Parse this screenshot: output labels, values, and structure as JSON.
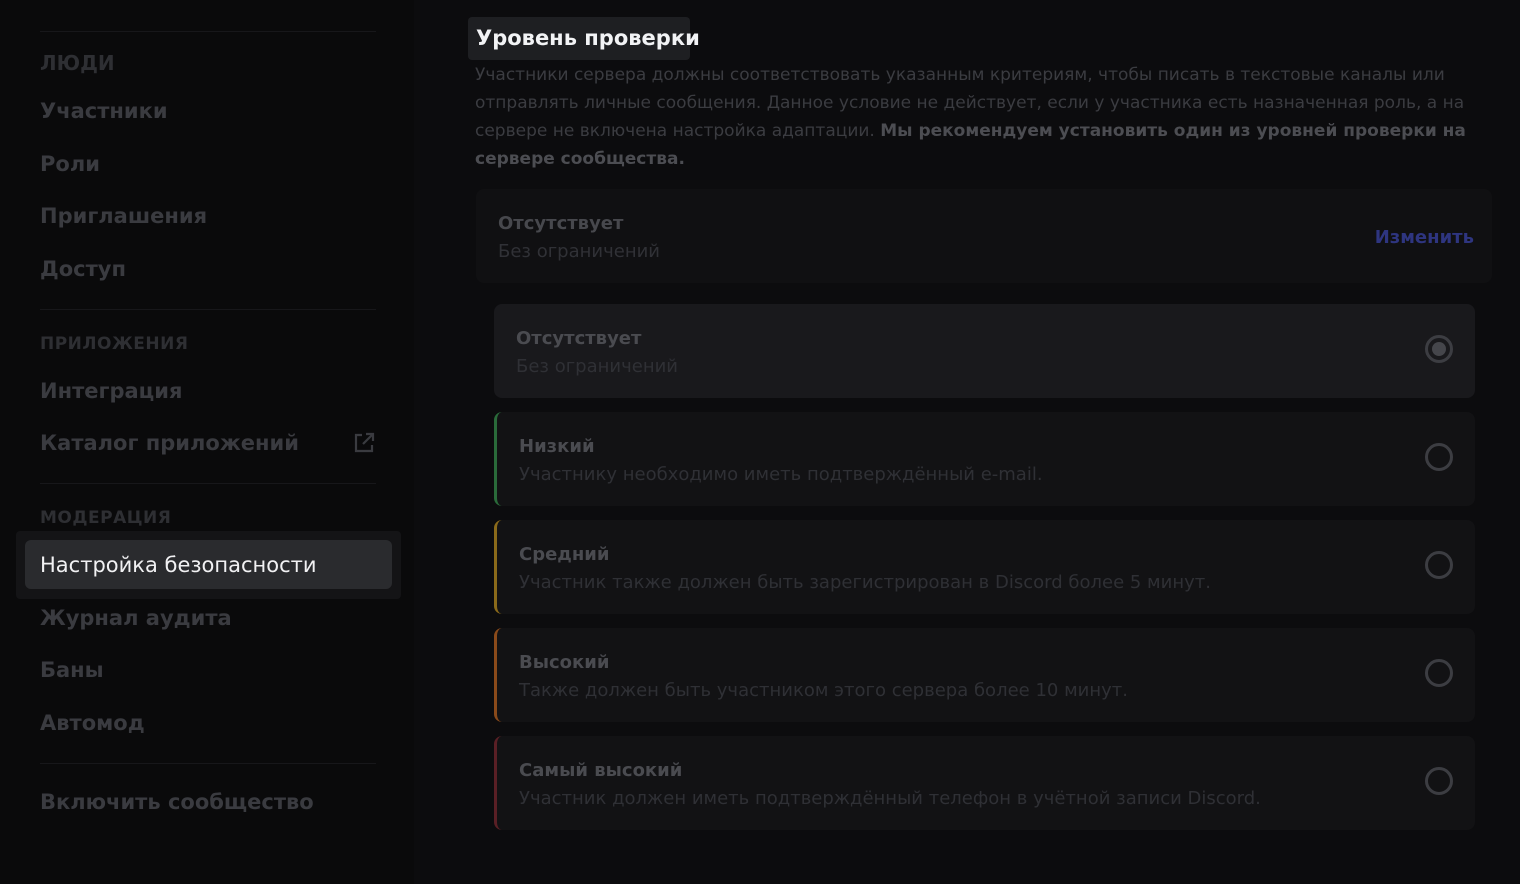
{
  "sidebar": {
    "section_people": "ЛЮДИ",
    "items_people": [
      "Участники",
      "Роли",
      "Приглашения",
      "Доступ"
    ],
    "section_apps": "ПРИЛОЖЕНИЯ",
    "items_apps": [
      "Интеграция",
      "Каталог приложений"
    ],
    "section_moderation": "МОДЕРАЦИЯ",
    "active_item": "Настройка безопасности",
    "items_moderation": [
      "Журнал аудита",
      "Баны",
      "Автомод"
    ],
    "enable_community": "Включить сообщество"
  },
  "main": {
    "title": "Уровень проверки",
    "description": "Участники сервера должны соответствовать указанным критериям, чтобы писать в текстовые каналы или отправлять личные сообщения. Данное условие не действует, если у участника есть назначенная роль, а на сервере не включена настройка адаптации.",
    "description_bold": "Мы рекомендуем установить один из уровней проверки на сервере сообщества.",
    "current": {
      "title": "Отсутствует",
      "subtitle": "Без ограничений",
      "change_label": "Изменить"
    },
    "options": [
      {
        "title": "Отсутствует",
        "subtitle": "Без ограничений",
        "color": "",
        "selected": true
      },
      {
        "title": "Низкий",
        "subtitle": "Участнику необходимо иметь подтверждённый e-mail.",
        "color": "#2a6b3a",
        "selected": false
      },
      {
        "title": "Средний",
        "subtitle": "Участник также должен быть зарегистрирован в Discord более 5 минут.",
        "color": "#8a6a1a",
        "selected": false
      },
      {
        "title": "Высокий",
        "subtitle": "Также должен быть участником этого сервера более 10 минут.",
        "color": "#8a4a1a",
        "selected": false
      },
      {
        "title": "Самый высокий",
        "subtitle": "Участник должен иметь подтверждённый телефон в учётной записи Discord.",
        "color": "#5a1f25",
        "selected": false
      }
    ]
  }
}
